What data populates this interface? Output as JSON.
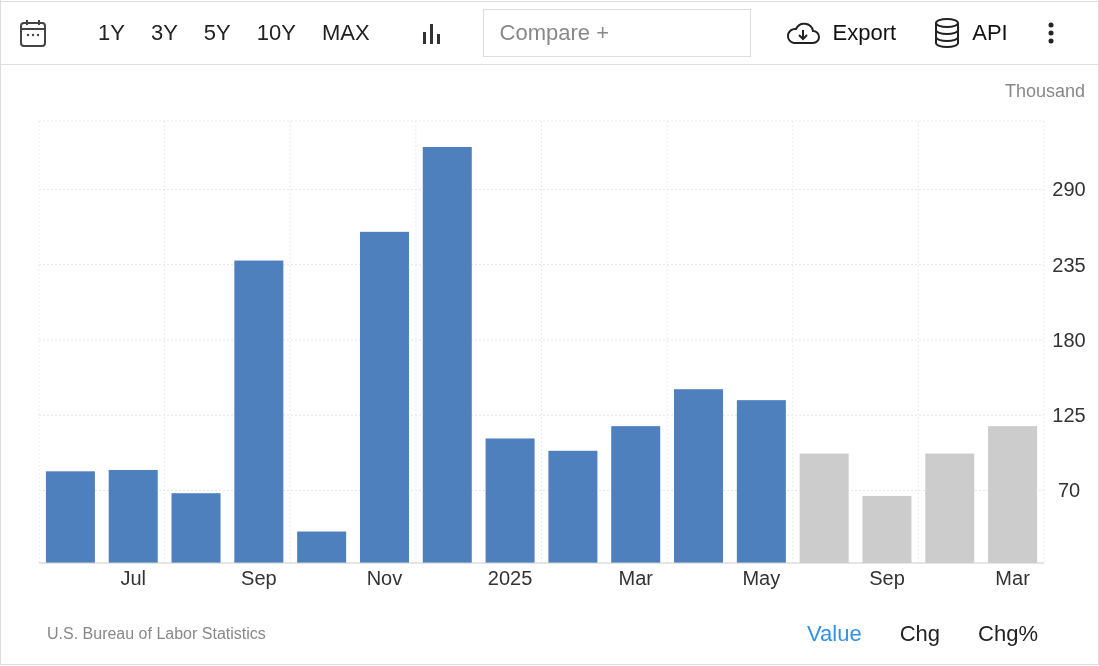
{
  "toolbar": {
    "ranges": [
      "1Y",
      "3Y",
      "5Y",
      "10Y",
      "MAX"
    ],
    "compare": {
      "placeholder": "Compare +"
    },
    "export": "Export",
    "api": "API"
  },
  "chart": {
    "unit": "Thousand",
    "chart_data": {
      "type": "bar",
      "ylim": [
        17,
        340
      ],
      "yticks": [
        70,
        125,
        180,
        235,
        290
      ],
      "grid": true,
      "categories": [
        null,
        "Jul",
        null,
        "Sep",
        null,
        "Nov",
        null,
        "2025",
        null,
        "Mar",
        null,
        "May",
        null,
        "Sep",
        null,
        "Mar"
      ],
      "series": [
        {
          "color": "#4d80bd",
          "values": [
            84,
            85,
            68,
            238,
            40,
            259,
            321,
            108,
            99,
            117,
            144,
            136,
            null,
            null,
            null,
            null
          ]
        },
        {
          "color": "#cccccc",
          "values": [
            null,
            null,
            null,
            null,
            null,
            null,
            null,
            null,
            null,
            null,
            null,
            null,
            97,
            66,
            97,
            117
          ]
        }
      ]
    }
  },
  "footer": {
    "source": "U.S. Bureau of Labor Statistics",
    "tabs": [
      {
        "label": "Value",
        "selected": true
      },
      {
        "label": "Chg",
        "selected": false
      },
      {
        "label": "Chg%",
        "selected": false
      }
    ]
  }
}
